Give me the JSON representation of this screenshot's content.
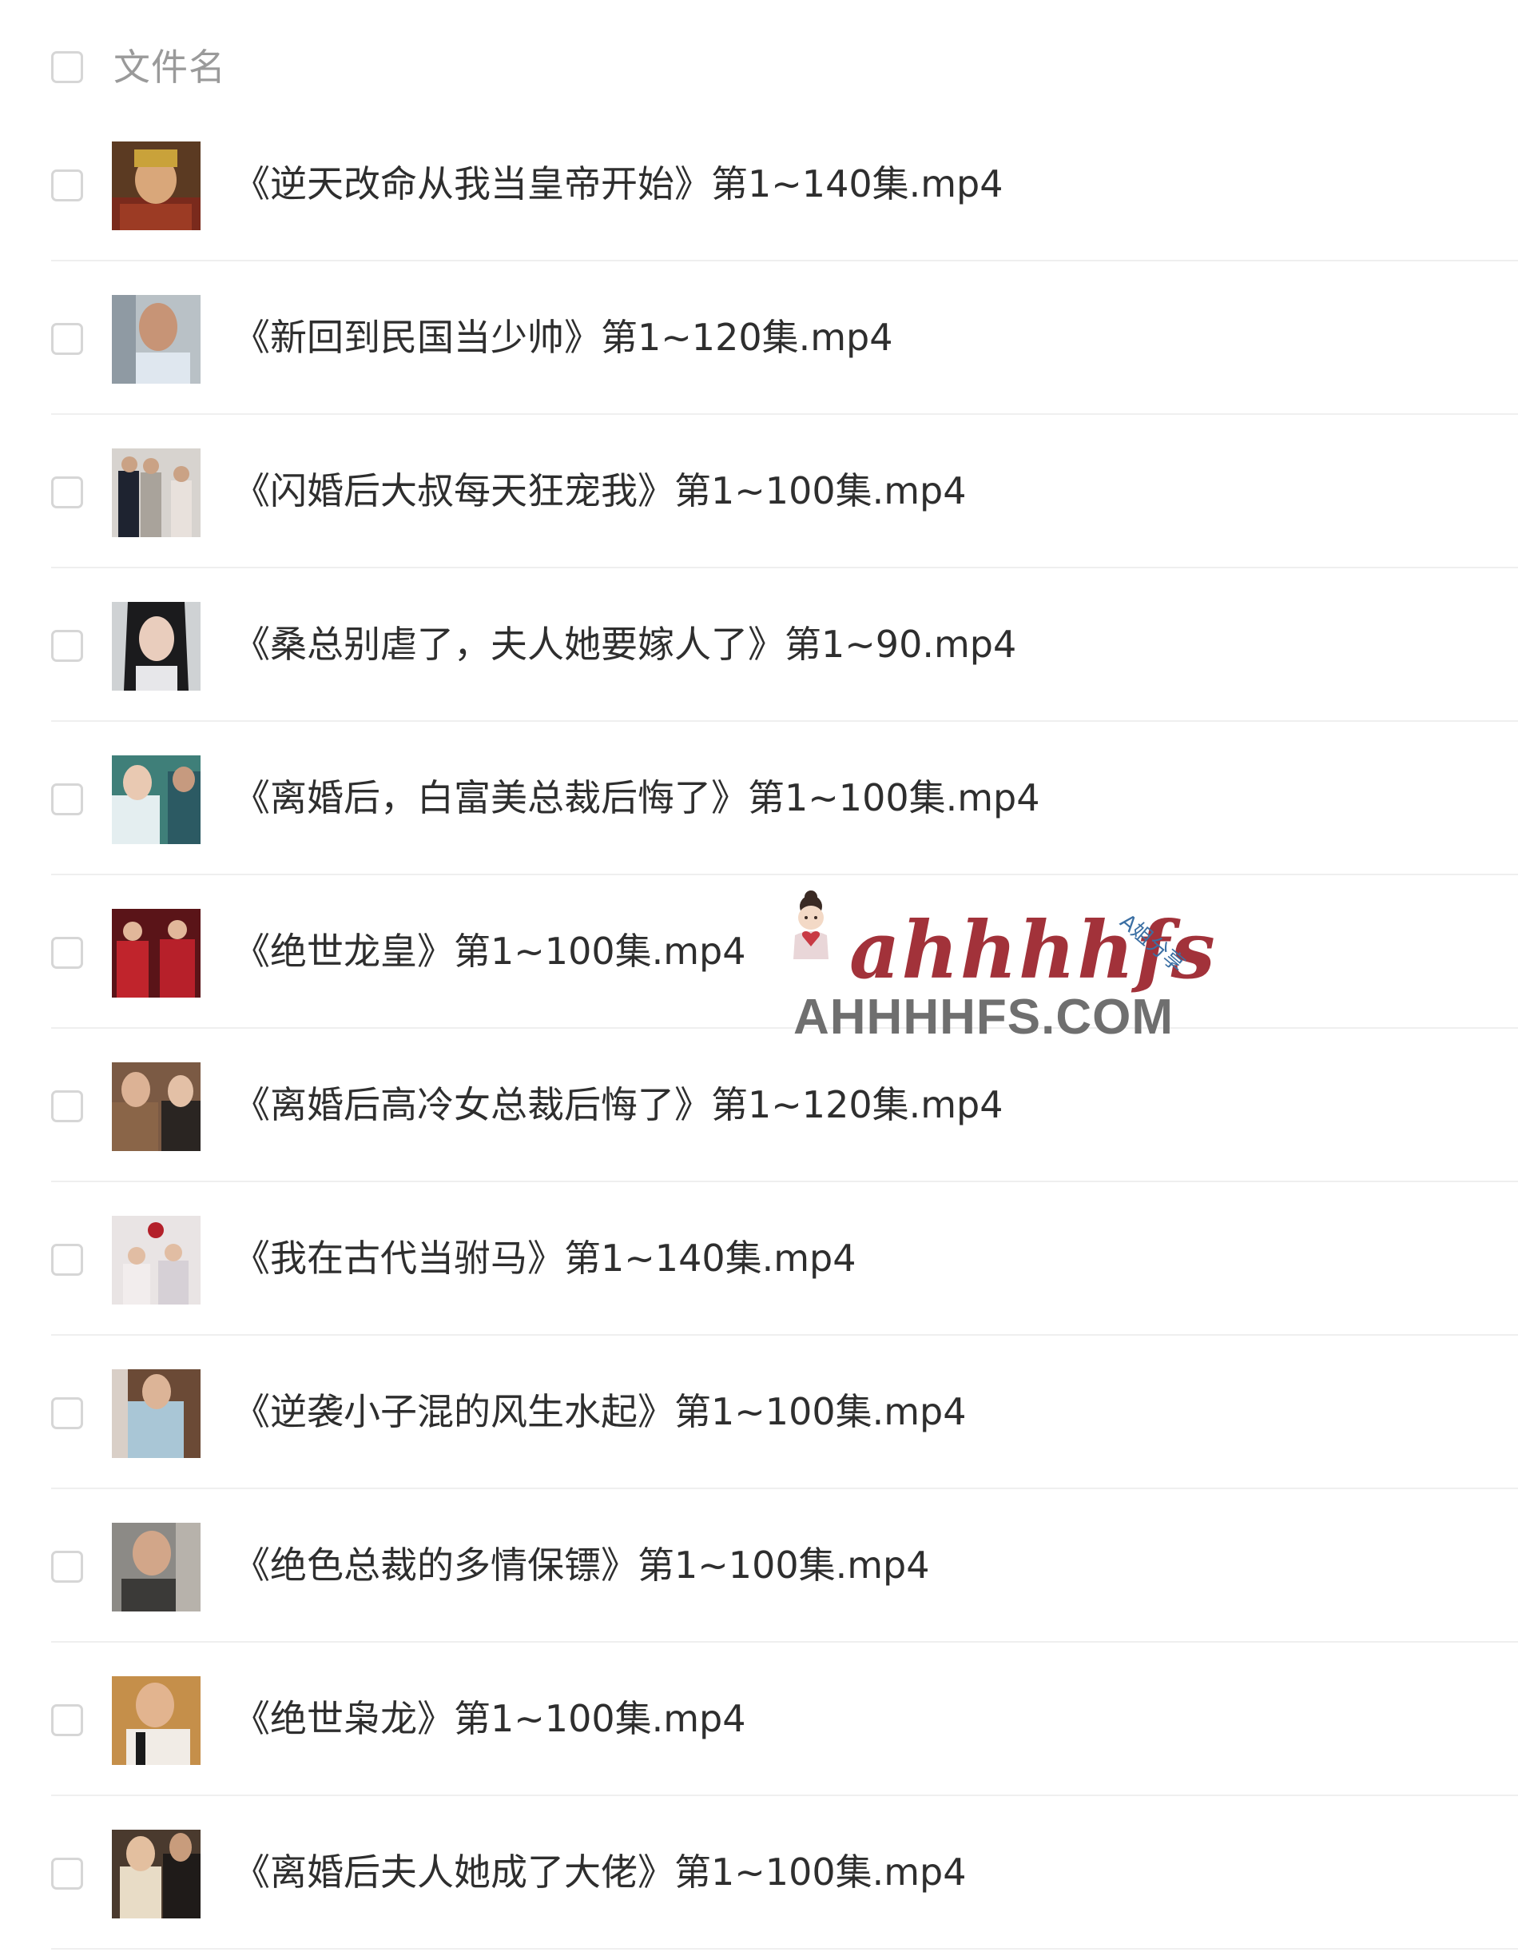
{
  "header": {
    "column_label": "文件名"
  },
  "files": [
    {
      "name": "《逆天改命从我当皇帝开始》第1~140集.mp4",
      "thumbnail": "video-thumbnail"
    },
    {
      "name": "《新回到民国当少帅》第1~120集.mp4",
      "thumbnail": "video-thumbnail"
    },
    {
      "name": "《闪婚后大叔每天狂宠我》第1~100集.mp4",
      "thumbnail": "video-thumbnail"
    },
    {
      "name": "《桑总别虐了，夫人她要嫁人了》第1~90.mp4",
      "thumbnail": "video-thumbnail"
    },
    {
      "name": "《离婚后，白富美总裁后悔了》第1~100集.mp4",
      "thumbnail": "video-thumbnail"
    },
    {
      "name": "《绝世龙皇》第1~100集.mp4",
      "thumbnail": "video-thumbnail"
    },
    {
      "name": "《离婚后高冷女总裁后悔了》第1~120集.mp4",
      "thumbnail": "video-thumbnail"
    },
    {
      "name": "《我在古代当驸马》第1~140集.mp4",
      "thumbnail": "video-thumbnail"
    },
    {
      "name": "《逆袭小子混的风生水起》第1~100集.mp4",
      "thumbnail": "video-thumbnail"
    },
    {
      "name": "《绝色总裁的多情保镖》第1~100集.mp4",
      "thumbnail": "video-thumbnail"
    },
    {
      "name": "《绝世枭龙》第1~100集.mp4",
      "thumbnail": "video-thumbnail"
    },
    {
      "name": "《离婚后夫人她成了大佬》第1~100集.mp4",
      "thumbnail": "video-thumbnail"
    }
  ],
  "watermark": {
    "script": "ahhhhfs",
    "tag": "A姐分享",
    "domain": "AHHHHFS.COM"
  },
  "colors": {
    "checkbox_border": "#d6d6d6",
    "header_text": "#9a9a9a",
    "file_text": "#2e2e2e",
    "divider": "#efefef",
    "watermark_script": "#a2323a",
    "watermark_domain": "#6f6f6f"
  }
}
